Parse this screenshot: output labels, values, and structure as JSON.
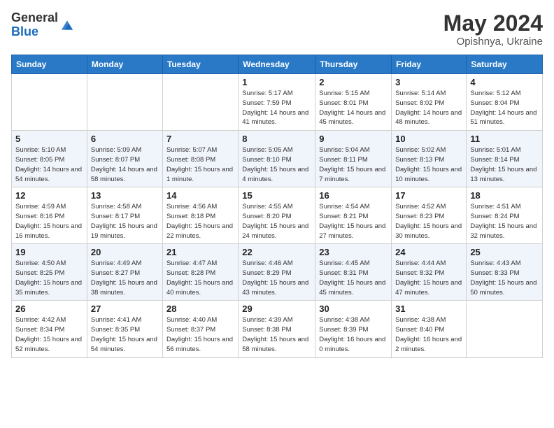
{
  "header": {
    "logo_line1": "General",
    "logo_line2": "Blue",
    "title": "May 2024",
    "location": "Opishnya, Ukraine"
  },
  "weekdays": [
    "Sunday",
    "Monday",
    "Tuesday",
    "Wednesday",
    "Thursday",
    "Friday",
    "Saturday"
  ],
  "weeks": [
    [
      {
        "day": "",
        "sunrise": "",
        "sunset": "",
        "daylight": ""
      },
      {
        "day": "",
        "sunrise": "",
        "sunset": "",
        "daylight": ""
      },
      {
        "day": "",
        "sunrise": "",
        "sunset": "",
        "daylight": ""
      },
      {
        "day": "1",
        "sunrise": "Sunrise: 5:17 AM",
        "sunset": "Sunset: 7:59 PM",
        "daylight": "Daylight: 14 hours and 41 minutes."
      },
      {
        "day": "2",
        "sunrise": "Sunrise: 5:15 AM",
        "sunset": "Sunset: 8:01 PM",
        "daylight": "Daylight: 14 hours and 45 minutes."
      },
      {
        "day": "3",
        "sunrise": "Sunrise: 5:14 AM",
        "sunset": "Sunset: 8:02 PM",
        "daylight": "Daylight: 14 hours and 48 minutes."
      },
      {
        "day": "4",
        "sunrise": "Sunrise: 5:12 AM",
        "sunset": "Sunset: 8:04 PM",
        "daylight": "Daylight: 14 hours and 51 minutes."
      }
    ],
    [
      {
        "day": "5",
        "sunrise": "Sunrise: 5:10 AM",
        "sunset": "Sunset: 8:05 PM",
        "daylight": "Daylight: 14 hours and 54 minutes."
      },
      {
        "day": "6",
        "sunrise": "Sunrise: 5:09 AM",
        "sunset": "Sunset: 8:07 PM",
        "daylight": "Daylight: 14 hours and 58 minutes."
      },
      {
        "day": "7",
        "sunrise": "Sunrise: 5:07 AM",
        "sunset": "Sunset: 8:08 PM",
        "daylight": "Daylight: 15 hours and 1 minute."
      },
      {
        "day": "8",
        "sunrise": "Sunrise: 5:05 AM",
        "sunset": "Sunset: 8:10 PM",
        "daylight": "Daylight: 15 hours and 4 minutes."
      },
      {
        "day": "9",
        "sunrise": "Sunrise: 5:04 AM",
        "sunset": "Sunset: 8:11 PM",
        "daylight": "Daylight: 15 hours and 7 minutes."
      },
      {
        "day": "10",
        "sunrise": "Sunrise: 5:02 AM",
        "sunset": "Sunset: 8:13 PM",
        "daylight": "Daylight: 15 hours and 10 minutes."
      },
      {
        "day": "11",
        "sunrise": "Sunrise: 5:01 AM",
        "sunset": "Sunset: 8:14 PM",
        "daylight": "Daylight: 15 hours and 13 minutes."
      }
    ],
    [
      {
        "day": "12",
        "sunrise": "Sunrise: 4:59 AM",
        "sunset": "Sunset: 8:16 PM",
        "daylight": "Daylight: 15 hours and 16 minutes."
      },
      {
        "day": "13",
        "sunrise": "Sunrise: 4:58 AM",
        "sunset": "Sunset: 8:17 PM",
        "daylight": "Daylight: 15 hours and 19 minutes."
      },
      {
        "day": "14",
        "sunrise": "Sunrise: 4:56 AM",
        "sunset": "Sunset: 8:18 PM",
        "daylight": "Daylight: 15 hours and 22 minutes."
      },
      {
        "day": "15",
        "sunrise": "Sunrise: 4:55 AM",
        "sunset": "Sunset: 8:20 PM",
        "daylight": "Daylight: 15 hours and 24 minutes."
      },
      {
        "day": "16",
        "sunrise": "Sunrise: 4:54 AM",
        "sunset": "Sunset: 8:21 PM",
        "daylight": "Daylight: 15 hours and 27 minutes."
      },
      {
        "day": "17",
        "sunrise": "Sunrise: 4:52 AM",
        "sunset": "Sunset: 8:23 PM",
        "daylight": "Daylight: 15 hours and 30 minutes."
      },
      {
        "day": "18",
        "sunrise": "Sunrise: 4:51 AM",
        "sunset": "Sunset: 8:24 PM",
        "daylight": "Daylight: 15 hours and 32 minutes."
      }
    ],
    [
      {
        "day": "19",
        "sunrise": "Sunrise: 4:50 AM",
        "sunset": "Sunset: 8:25 PM",
        "daylight": "Daylight: 15 hours and 35 minutes."
      },
      {
        "day": "20",
        "sunrise": "Sunrise: 4:49 AM",
        "sunset": "Sunset: 8:27 PM",
        "daylight": "Daylight: 15 hours and 38 minutes."
      },
      {
        "day": "21",
        "sunrise": "Sunrise: 4:47 AM",
        "sunset": "Sunset: 8:28 PM",
        "daylight": "Daylight: 15 hours and 40 minutes."
      },
      {
        "day": "22",
        "sunrise": "Sunrise: 4:46 AM",
        "sunset": "Sunset: 8:29 PM",
        "daylight": "Daylight: 15 hours and 43 minutes."
      },
      {
        "day": "23",
        "sunrise": "Sunrise: 4:45 AM",
        "sunset": "Sunset: 8:31 PM",
        "daylight": "Daylight: 15 hours and 45 minutes."
      },
      {
        "day": "24",
        "sunrise": "Sunrise: 4:44 AM",
        "sunset": "Sunset: 8:32 PM",
        "daylight": "Daylight: 15 hours and 47 minutes."
      },
      {
        "day": "25",
        "sunrise": "Sunrise: 4:43 AM",
        "sunset": "Sunset: 8:33 PM",
        "daylight": "Daylight: 15 hours and 50 minutes."
      }
    ],
    [
      {
        "day": "26",
        "sunrise": "Sunrise: 4:42 AM",
        "sunset": "Sunset: 8:34 PM",
        "daylight": "Daylight: 15 hours and 52 minutes."
      },
      {
        "day": "27",
        "sunrise": "Sunrise: 4:41 AM",
        "sunset": "Sunset: 8:35 PM",
        "daylight": "Daylight: 15 hours and 54 minutes."
      },
      {
        "day": "28",
        "sunrise": "Sunrise: 4:40 AM",
        "sunset": "Sunset: 8:37 PM",
        "daylight": "Daylight: 15 hours and 56 minutes."
      },
      {
        "day": "29",
        "sunrise": "Sunrise: 4:39 AM",
        "sunset": "Sunset: 8:38 PM",
        "daylight": "Daylight: 15 hours and 58 minutes."
      },
      {
        "day": "30",
        "sunrise": "Sunrise: 4:38 AM",
        "sunset": "Sunset: 8:39 PM",
        "daylight": "Daylight: 16 hours and 0 minutes."
      },
      {
        "day": "31",
        "sunrise": "Sunrise: 4:38 AM",
        "sunset": "Sunset: 8:40 PM",
        "daylight": "Daylight: 16 hours and 2 minutes."
      },
      {
        "day": "",
        "sunrise": "",
        "sunset": "",
        "daylight": ""
      }
    ]
  ]
}
